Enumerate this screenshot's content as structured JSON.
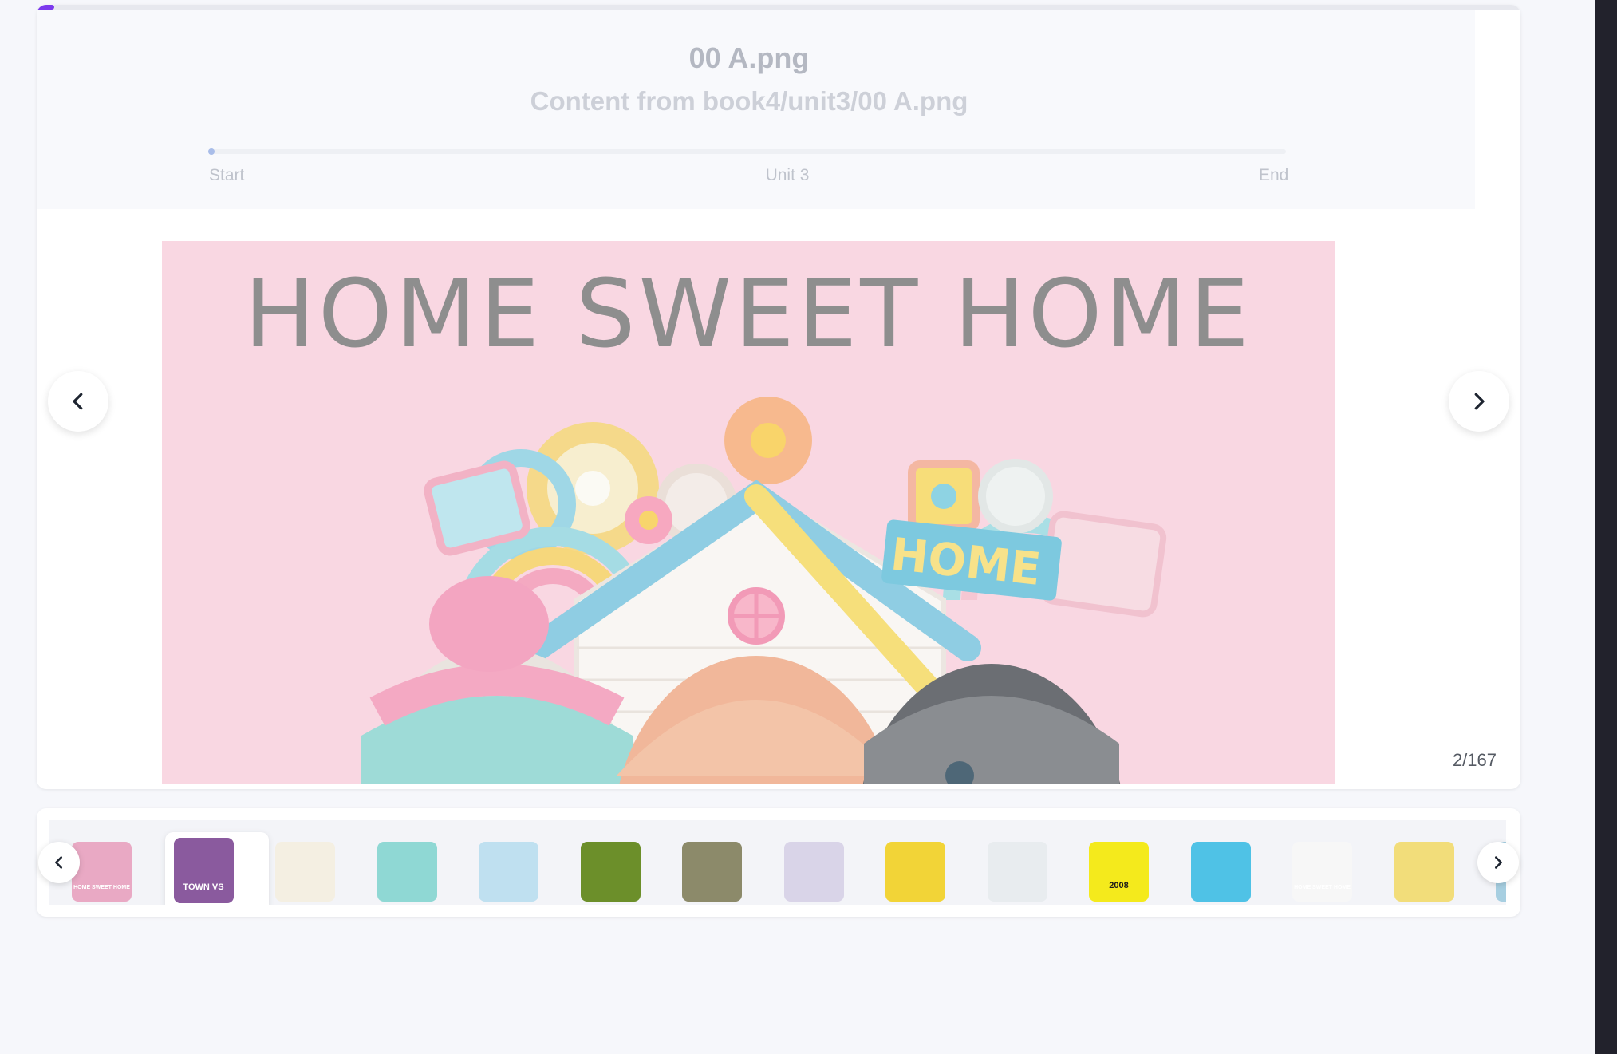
{
  "viewer": {
    "progress_fraction": 0.012,
    "title": "00 A.png",
    "subtitle": "Content from book4/unit3/00 A.png",
    "unit_progress_fraction": 0.004,
    "markers": {
      "start": "Start",
      "middle": "Unit 3",
      "end": "End"
    },
    "slide_headline": "HOME SWEET HOME",
    "slide_sign": "HOME",
    "counter": "2/167",
    "prev_icon": "chevron-left-icon",
    "next_icon": "chevron-right-icon"
  },
  "thumbnails": {
    "active_index": 1,
    "prev_icon": "chevron-left-icon",
    "next_icon": "chevron-right-icon",
    "items": [
      {
        "label": "HOME SWEET HOME",
        "bg": "#e9a9c4"
      },
      {
        "label": "TOWN VS",
        "bg": "#8a5a9e"
      },
      {
        "label": "",
        "bg": "#f4efe2"
      },
      {
        "label": "",
        "bg": "#8fd8d4"
      },
      {
        "label": "",
        "bg": "#bfe0f0"
      },
      {
        "label": "",
        "bg": "#6c8f2a"
      },
      {
        "label": "",
        "bg": "#8c8a6a"
      },
      {
        "label": "",
        "bg": "#d9d4e8"
      },
      {
        "label": "",
        "bg": "#f2d437"
      },
      {
        "label": "",
        "bg": "#e8ecef"
      },
      {
        "label": "2008",
        "bg": "#f4ea1c"
      },
      {
        "label": "",
        "bg": "#4fc2e6"
      },
      {
        "label": "HOME SWEET HOME",
        "bg": "#f7f7f7"
      },
      {
        "label": "",
        "bg": "#f2dd7a"
      }
    ]
  }
}
